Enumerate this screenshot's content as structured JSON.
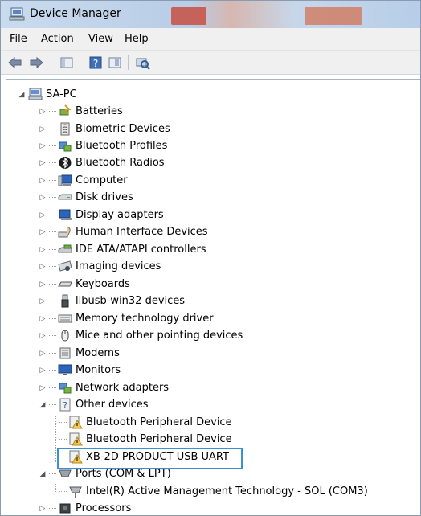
{
  "window": {
    "title": "Device Manager"
  },
  "menu": [
    "File",
    "Action",
    "View",
    "Help"
  ],
  "tree": {
    "root": "SA-PC",
    "categories": [
      {
        "label": "Batteries",
        "icon": "battery-icon"
      },
      {
        "label": "Biometric Devices",
        "icon": "biometric-icon"
      },
      {
        "label": "Bluetooth Profiles",
        "icon": "bluetooth-profile-icon"
      },
      {
        "label": "Bluetooth Radios",
        "icon": "bluetooth-icon"
      },
      {
        "label": "Computer",
        "icon": "computer-icon"
      },
      {
        "label": "Disk drives",
        "icon": "disk-drive-icon"
      },
      {
        "label": "Display adapters",
        "icon": "display-adapter-icon"
      },
      {
        "label": "Human Interface Devices",
        "icon": "hid-icon"
      },
      {
        "label": "IDE ATA/ATAPI controllers",
        "icon": "ide-controller-icon"
      },
      {
        "label": "Imaging devices",
        "icon": "imaging-icon"
      },
      {
        "label": "Keyboards",
        "icon": "keyboard-icon"
      },
      {
        "label": "libusb-win32 devices",
        "icon": "usb-icon"
      },
      {
        "label": "Memory technology driver",
        "icon": "memory-icon"
      },
      {
        "label": "Mice and other pointing devices",
        "icon": "mouse-icon"
      },
      {
        "label": "Modems",
        "icon": "modem-icon"
      },
      {
        "label": "Monitors",
        "icon": "monitor-icon"
      },
      {
        "label": "Network adapters",
        "icon": "network-adapter-icon"
      },
      {
        "label": "Other devices",
        "icon": "other-devices-icon"
      }
    ],
    "other_devices_children": [
      {
        "label": "Bluetooth Peripheral Device",
        "icon": "warning-device-icon"
      },
      {
        "label": "Bluetooth Peripheral Device",
        "icon": "warning-device-icon"
      },
      {
        "label": "XB-2D PRODUCT USB UART",
        "icon": "warning-device-icon"
      }
    ],
    "ports": {
      "label": "Ports (COM & LPT)",
      "children": [
        "Intel(R) Active Management Technology - SOL (COM3)"
      ]
    },
    "processors": "Processors"
  },
  "colors": {
    "highlight": "#3a8fd5",
    "warning": "#f2c94c"
  }
}
